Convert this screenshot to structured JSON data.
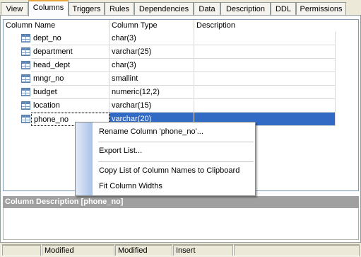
{
  "tabs": [
    {
      "label": "View"
    },
    {
      "label": "Columns",
      "active": true
    },
    {
      "label": "Triggers"
    },
    {
      "label": "Rules"
    },
    {
      "label": "Dependencies"
    },
    {
      "label": "Data"
    },
    {
      "label": "Description"
    },
    {
      "label": "DDL"
    },
    {
      "label": "Permissions"
    }
  ],
  "grid": {
    "headers": {
      "name": "Column Name",
      "type": "Column Type",
      "description": "Description"
    },
    "rows": [
      {
        "name": "dept_no",
        "type": "char(3)",
        "description": ""
      },
      {
        "name": "department",
        "type": "varchar(25)",
        "description": ""
      },
      {
        "name": "head_dept",
        "type": "char(3)",
        "description": ""
      },
      {
        "name": "mngr_no",
        "type": "smallint",
        "description": ""
      },
      {
        "name": "budget",
        "type": "numeric(12,2)",
        "description": ""
      },
      {
        "name": "location",
        "type": "varchar(15)",
        "description": ""
      },
      {
        "name": "phone_no",
        "type": "varchar(20)",
        "description": "",
        "selected": true
      }
    ],
    "row_icon": "table-column-icon"
  },
  "context_menu": {
    "items": [
      {
        "label": "Rename Column 'phone_no'..."
      },
      {
        "label": "Export List..."
      },
      {
        "label": "Copy List of Column Names to Clipboard"
      },
      {
        "label": "Fit Column Widths"
      }
    ]
  },
  "description_panel": {
    "title": "Column Description [phone_no]",
    "text": ""
  },
  "status_bar": [
    "",
    "Modified",
    "Modified",
    "Insert",
    ""
  ],
  "colors": {
    "selection": "#316ac5",
    "tab_accent": "#e8a33a",
    "desc_header": "#a0a0a0",
    "menu_rail": "#a9c1e8"
  }
}
